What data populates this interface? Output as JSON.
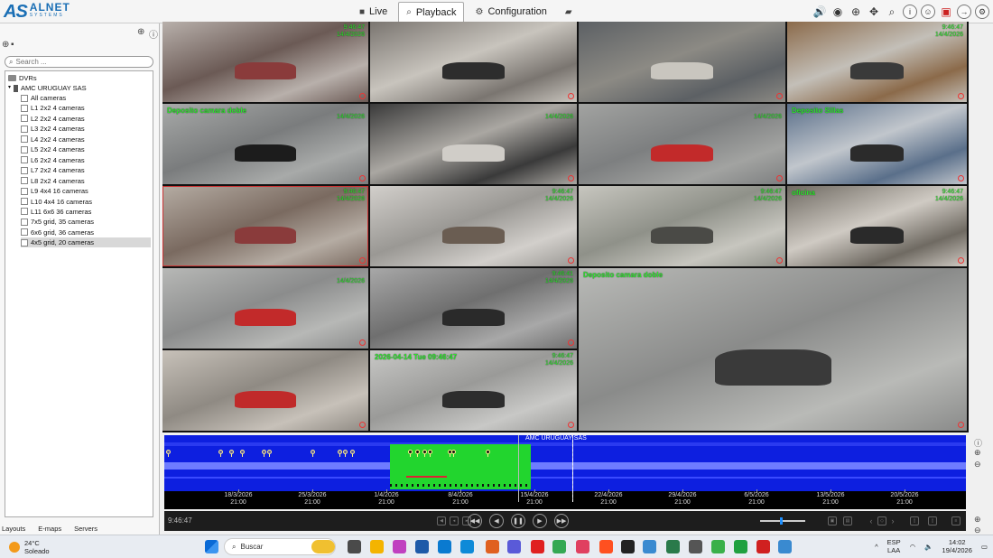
{
  "brand": {
    "mark": "AS",
    "name": "ALNET",
    "sub": "SYSTEMS"
  },
  "tabs": [
    {
      "label": "Live",
      "icon": "camera-icon",
      "active": false
    },
    {
      "label": "Playback",
      "icon": "search-icon",
      "active": true
    },
    {
      "label": "Configuration",
      "icon": "gear-icon",
      "active": false
    }
  ],
  "search": {
    "placeholder": "Search ..."
  },
  "tree": {
    "root": "DVRs",
    "dvr": "AMC URUGUAY SAS",
    "items": [
      "All cameras",
      "L1 2x2 4 cameras",
      "L2 2x2 4 cameras",
      "L3 2x2 4 cameras",
      "L4 2x2 4 cameras",
      "L5 2x2 4 cameras",
      "L6 2x2 4 cameras",
      "L7 2x2 4 cameras",
      "L8 2x2 4 cameras",
      "L9 4x4 16 cameras",
      "L10 4x4 16 cameras",
      "L11 6x6 36 cameras",
      "7x5 grid, 35 cameras",
      "6x6 grid, 36 cameras",
      "4x5 grid, 20 cameras"
    ],
    "selected_index": 14
  },
  "sidebar_tabs": [
    "Layouts",
    "E-maps",
    "Servers"
  ],
  "cameras": [
    {
      "label": "",
      "time": "9:46:47",
      "date": "14/4/2026"
    },
    {
      "label": "",
      "time": "",
      "date": ""
    },
    {
      "label": "",
      "time": "",
      "date": ""
    },
    {
      "label": "",
      "time": "9:46:47",
      "date": "14/4/2026"
    },
    {
      "label": "Deposito camara doble",
      "time": "",
      "date": "14/4/2026"
    },
    {
      "label": "",
      "time": "",
      "date": "14/4/2026"
    },
    {
      "label": "",
      "time": "",
      "date": "14/4/2026"
    },
    {
      "label": "Deposito Sillas",
      "time": "",
      "date": ""
    },
    {
      "label": "",
      "time": "9:46:47",
      "date": "14/4/2026"
    },
    {
      "label": "",
      "time": "9:46:47",
      "date": "14/4/2026"
    },
    {
      "label": "",
      "time": "9:46:47",
      "date": "14/4/2026"
    },
    {
      "label": "oficina",
      "time": "9:46:47",
      "date": "14/4/2026"
    },
    {
      "label": "",
      "time": "",
      "date": "14/4/2026"
    },
    {
      "label": "",
      "time": "9:46:41",
      "date": "14/4/2026"
    },
    {
      "label": "Deposito camara doble",
      "time": "",
      "date": ""
    },
    {
      "label": "",
      "time": "",
      "date": ""
    },
    {
      "label": "2026-04-14 Tue 09:46:47",
      "time": "9:46:47",
      "date": "14/4/2026"
    }
  ],
  "timeline": {
    "title": "AMC URUGUAY SAS",
    "ticks": [
      {
        "date": "18/3/2026",
        "time": "21:00"
      },
      {
        "date": "25/3/2026",
        "time": "21:00"
      },
      {
        "date": "1/4/2026",
        "time": "21:00"
      },
      {
        "date": "8/4/2026",
        "time": "21:00"
      },
      {
        "date": "15/4/2026",
        "time": "21:00"
      },
      {
        "date": "22/4/2026",
        "time": "21:00"
      },
      {
        "date": "29/4/2026",
        "time": "21:00"
      },
      {
        "date": "6/5/2026",
        "time": "21:00"
      },
      {
        "date": "13/5/2026",
        "time": "21:00"
      },
      {
        "date": "20/5/2026",
        "time": "21:00"
      }
    ],
    "current_time": "9:46:47"
  },
  "taskbar": {
    "weather_temp": "24°C",
    "weather_desc": "Soleado",
    "search_label": "Buscar",
    "lang_top": "ESP",
    "lang_bottom": "LAA",
    "clock_time": "14:02",
    "clock_date": "19/4/2026"
  },
  "colors": {
    "timeline_blue": "#0d1fe0",
    "timeline_light_blue": "#6e7cff",
    "recorded_green": "#22d52e",
    "cam_text": "#2ee62e",
    "brand_blue": "#1b6fb5"
  }
}
